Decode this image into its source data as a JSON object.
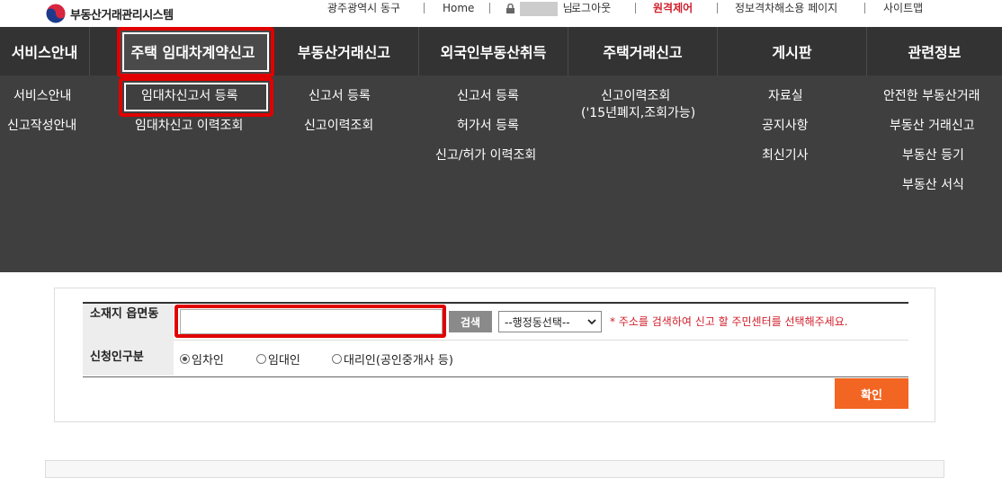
{
  "header": {
    "logo_text": "부동산거래관리시스템",
    "region": "광주광역시 동구",
    "home": "Home",
    "user_suffix": "님",
    "logout": "로그아웃",
    "remote": "원격제어",
    "info_page": "정보격차해소용 페이지",
    "sitemap": "사이트맵"
  },
  "nav": {
    "items": [
      {
        "label": "서비스안내"
      },
      {
        "label": "주택 임대차계약신고"
      },
      {
        "label": "부동산거래신고"
      },
      {
        "label": "외국인부동산취득"
      },
      {
        "label": "주택거래신고"
      },
      {
        "label": "게시판"
      },
      {
        "label": "관련정보"
      }
    ],
    "sub": {
      "service": [
        "서비스안내",
        "신고작성안내"
      ],
      "lease": [
        "임대차신고서 등록",
        "임대차신고 이력조회"
      ],
      "realestate": [
        "신고서 등록",
        "신고이력조회"
      ],
      "foreign": [
        "신고서 등록",
        "허가서 등록",
        "신고/허가 이력조회"
      ],
      "housing": [
        "신고이력조회",
        "('15년폐지,조회가능)"
      ],
      "board": [
        "자료실",
        "공지사항",
        "최신기사"
      ],
      "related": [
        "안전한 부동산거래",
        "부동산 거래신고",
        "부동산 등기",
        "부동산 서식"
      ]
    }
  },
  "form": {
    "address_label": "소재지 읍면동",
    "address_value": "",
    "search_label": "검색",
    "select_value": "--행정동선택--",
    "notice": "* 주소를 검색하여 신고 할 주민센터를 선택해주세요.",
    "applicant_label": "신청인구분",
    "options": [
      "임차인",
      "임대인",
      "대리인(공인중개사 등)"
    ],
    "selected_option": "임차인",
    "confirm_label": "확인"
  }
}
